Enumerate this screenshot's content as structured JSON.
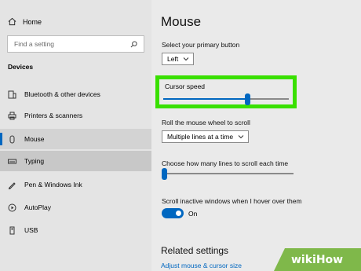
{
  "sidebar": {
    "home_label": "Home",
    "search_placeholder": "Find a setting",
    "section_title": "Devices",
    "items": [
      {
        "label": "Bluetooth & other devices",
        "icon": "bluetooth-devices-icon"
      },
      {
        "label": "Printers & scanners",
        "icon": "printer-icon"
      },
      {
        "label": "Mouse",
        "icon": "mouse-icon",
        "selected": true
      },
      {
        "label": "Typing",
        "icon": "keyboard-icon"
      },
      {
        "label": "Pen & Windows Ink",
        "icon": "pen-icon"
      },
      {
        "label": "AutoPlay",
        "icon": "autoplay-icon"
      },
      {
        "label": "USB",
        "icon": "usb-icon"
      }
    ]
  },
  "main": {
    "title": "Mouse",
    "primary_button": {
      "label": "Select your primary button",
      "value": "Left"
    },
    "cursor_speed": {
      "label": "Cursor speed",
      "value_fraction": 0.68
    },
    "scroll_wheel": {
      "label": "Roll the mouse wheel to scroll",
      "value": "Multiple lines at a time"
    },
    "scroll_lines": {
      "label": "Choose how many lines to scroll each time",
      "value_fraction": 0.0
    },
    "inactive_scroll": {
      "label": "Scroll inactive windows when I hover over them",
      "state": "On"
    },
    "related_title": "Related settings",
    "related_link": "Adjust mouse & cursor size"
  },
  "watermark": {
    "part1": "wiki",
    "part2": "How"
  },
  "colors": {
    "accent": "#0067c0",
    "highlight": "#39e000",
    "watermark": "#7fb84a"
  }
}
